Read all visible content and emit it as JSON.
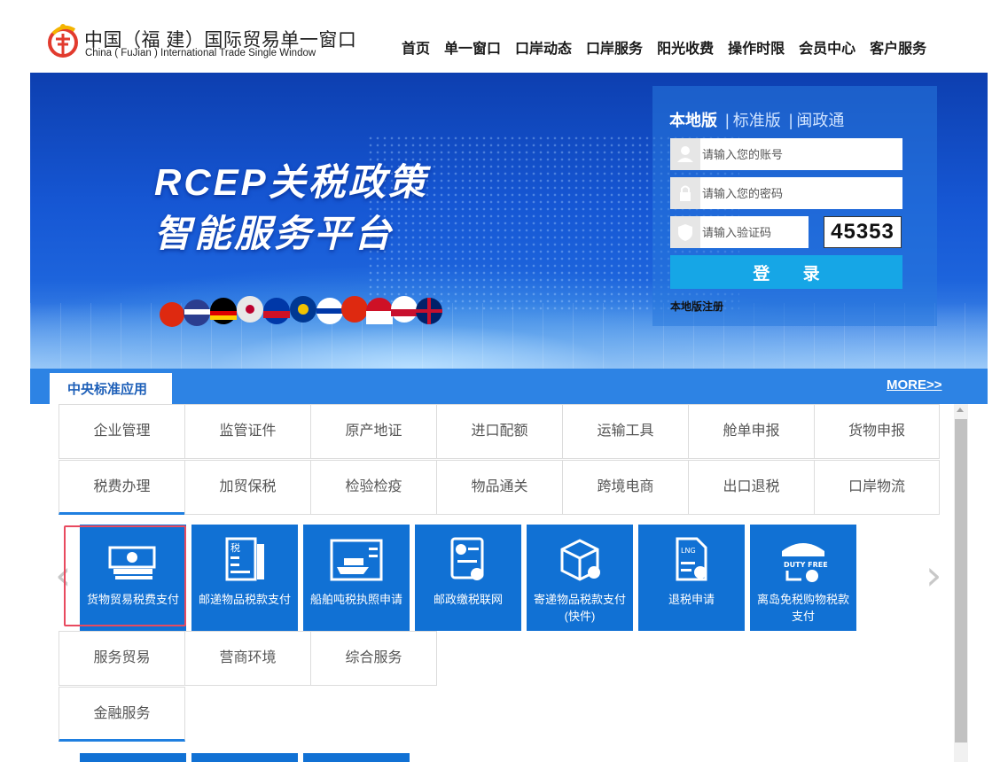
{
  "header": {
    "title_cn": "中国（福 建）国际贸易单一窗口",
    "title_en": "China (  FuJian  ) International Trade Single  Window",
    "nav": [
      "首页",
      "单一窗口",
      "口岸动态",
      "口岸服务",
      "阳光收费",
      "操作时限",
      "会员中心",
      "客户服务"
    ]
  },
  "banner": {
    "headline_line1": "RCEP关税政策",
    "headline_line2": "智能服务平台"
  },
  "login": {
    "tab_active": "本地版",
    "tab_2": "标准版",
    "tab_3": "闽政通",
    "tab_sep": "|",
    "account_placeholder": "请输入您的账号",
    "password_placeholder": "请输入您的密码",
    "captcha_placeholder": "请输入验证码",
    "captcha_code": "45353",
    "login_button": "登 录",
    "register_link": "本地版注册"
  },
  "section": {
    "tab": "中央标准应用",
    "more": "MORE>>"
  },
  "categories": {
    "row1": [
      "企业管理",
      "监管证件",
      "原产地证",
      "进口配额",
      "运输工具",
      "舱单申报",
      "货物申报"
    ],
    "row2": [
      "税费办理",
      "加贸保税",
      "检验检疫",
      "物品通关",
      "跨境电商",
      "出口退税",
      "口岸物流"
    ],
    "row3": [
      "服务贸易",
      "营商环境",
      "综合服务"
    ],
    "row4": [
      "金融服务"
    ]
  },
  "tiles": [
    {
      "label": "货物贸易税费支付",
      "icon": "money-icon"
    },
    {
      "label": "邮递物品税款支付",
      "icon": "tax-document-icon"
    },
    {
      "label": "船舶吨税执照申请",
      "icon": "ship-icon"
    },
    {
      "label": "邮政缴税联网",
      "icon": "tax-card-icon"
    },
    {
      "label": "寄递物品税款支付(快件)",
      "icon": "package-icon"
    },
    {
      "label": "退税申请",
      "icon": "lng-document-icon"
    },
    {
      "label": "离岛免税购物税款支付",
      "icon": "duty-free-shop-icon"
    }
  ],
  "colors": {
    "accent_blue": "#1171d4",
    "section_bar": "#2d83e4",
    "login_button": "#16a6e6",
    "highlight": "#e84a5f"
  }
}
